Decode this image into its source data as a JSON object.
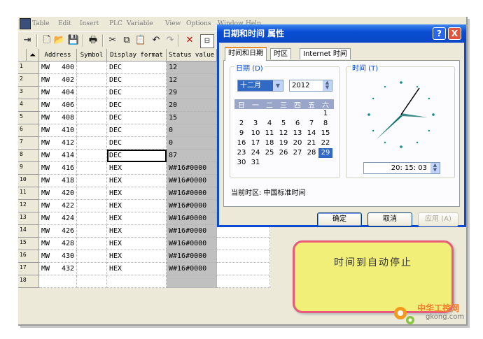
{
  "menu": [
    "Table",
    "Edit",
    "Insert",
    "PLC",
    "Variable",
    "View",
    "Options",
    "Window",
    "Help"
  ],
  "table": {
    "headers": [
      "Address",
      "Symbol",
      "Display format",
      "Status value"
    ],
    "rows": [
      {
        "n": "1",
        "area": "MW",
        "addr": "400",
        "fmt": "DEC",
        "val": "12"
      },
      {
        "n": "2",
        "area": "MW",
        "addr": "402",
        "fmt": "DEC",
        "val": "12"
      },
      {
        "n": "3",
        "area": "MW",
        "addr": "404",
        "fmt": "DEC",
        "val": "29"
      },
      {
        "n": "4",
        "area": "MW",
        "addr": "406",
        "fmt": "DEC",
        "val": "20"
      },
      {
        "n": "5",
        "area": "MW",
        "addr": "408",
        "fmt": "DEC",
        "val": "15"
      },
      {
        "n": "6",
        "area": "MW",
        "addr": "410",
        "fmt": "DEC",
        "val": "0"
      },
      {
        "n": "7",
        "area": "MW",
        "addr": "412",
        "fmt": "DEC",
        "val": "0"
      },
      {
        "n": "8",
        "area": "MW",
        "addr": "414",
        "fmt": "DEC",
        "val": "87"
      },
      {
        "n": "9",
        "area": "MW",
        "addr": "416",
        "fmt": "HEX",
        "val": "W#16#0000"
      },
      {
        "n": "10",
        "area": "MW",
        "addr": "418",
        "fmt": "HEX",
        "val": "W#16#0000"
      },
      {
        "n": "11",
        "area": "MW",
        "addr": "420",
        "fmt": "HEX",
        "val": "W#16#0000"
      },
      {
        "n": "12",
        "area": "MW",
        "addr": "422",
        "fmt": "HEX",
        "val": "W#16#0000"
      },
      {
        "n": "13",
        "area": "MW",
        "addr": "424",
        "fmt": "HEX",
        "val": "W#16#0000"
      },
      {
        "n": "14",
        "area": "MW",
        "addr": "426",
        "fmt": "HEX",
        "val": "W#16#0000"
      },
      {
        "n": "15",
        "area": "MW",
        "addr": "428",
        "fmt": "HEX",
        "val": "W#16#0000"
      },
      {
        "n": "16",
        "area": "MW",
        "addr": "430",
        "fmt": "HEX",
        "val": "W#16#0000"
      },
      {
        "n": "17",
        "area": "MW",
        "addr": "432",
        "fmt": "HEX",
        "val": "W#16#0000"
      },
      {
        "n": "18",
        "area": "",
        "addr": "",
        "fmt": "",
        "val": ""
      }
    ]
  },
  "dialog": {
    "title": "日期和时间 属性",
    "help_btn": "?",
    "close_btn": "X",
    "tabs": [
      "时间和日期",
      "时区",
      "Internet 时间"
    ],
    "date_group": "日期 (D)",
    "time_group": "时间 (T)",
    "month": "十二月",
    "year": "2012",
    "weekdays": [
      "日",
      "一",
      "二",
      "三",
      "四",
      "五",
      "六"
    ],
    "weeks": [
      [
        "",
        "",
        "",
        "",
        "",
        "",
        "1"
      ],
      [
        "2",
        "3",
        "4",
        "5",
        "6",
        "7",
        "8"
      ],
      [
        "9",
        "10",
        "11",
        "12",
        "13",
        "14",
        "15"
      ],
      [
        "16",
        "17",
        "18",
        "19",
        "20",
        "21",
        "22"
      ],
      [
        "23",
        "24",
        "25",
        "26",
        "27",
        "28",
        "29"
      ],
      [
        "30",
        "31",
        "",
        "",
        "",
        "",
        ""
      ]
    ],
    "selected_day": "29",
    "time": "20: 15: 03",
    "timezone": "当前时区: 中国标准时间",
    "ok": "确定",
    "cancel": "取消",
    "apply": "应用 (A)"
  },
  "note": "时间到自动停止",
  "watermark": {
    "site_cn": "中华工控网",
    "site_url": "gkong.com"
  }
}
